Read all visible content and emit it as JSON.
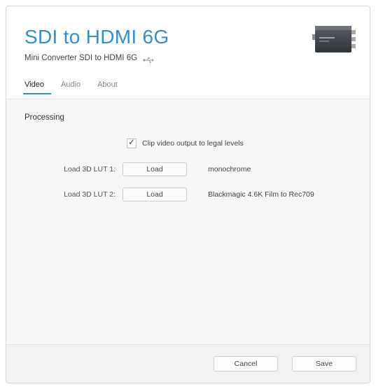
{
  "header": {
    "title": "SDI to HDMI 6G",
    "subtitle": "Mini Converter SDI to HDMI 6G",
    "usb_icon": "usb-icon",
    "device_icon": "device-image"
  },
  "tabs": [
    {
      "label": "Video",
      "active": true
    },
    {
      "label": "Audio",
      "active": false
    },
    {
      "label": "About",
      "active": false
    }
  ],
  "processing": {
    "section_title": "Processing",
    "clip_checkbox_label": "Clip video output to legal levels",
    "clip_checked": true,
    "luts": [
      {
        "label": "Load 3D LUT 1:",
        "button": "Load",
        "value": "monochrome"
      },
      {
        "label": "Load 3D LUT 2:",
        "button": "Load",
        "value": "Blackmagic 4.6K Film to Rec709"
      }
    ]
  },
  "footer": {
    "cancel_label": "Cancel",
    "save_label": "Save"
  },
  "colors": {
    "accent": "#2f8fd4"
  }
}
